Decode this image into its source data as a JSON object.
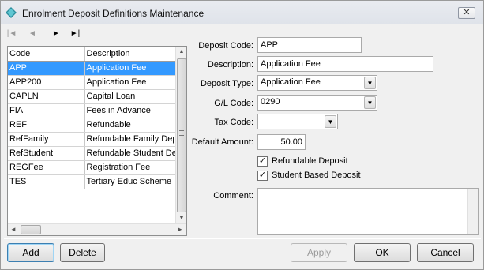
{
  "window": {
    "title": "Enrolment Deposit Definitions Maintenance"
  },
  "toolbar": {
    "buttons": [
      {
        "name": "first-record-icon",
        "glyph": "|◄"
      },
      {
        "name": "previous-record-icon",
        "glyph": "◄"
      },
      {
        "name": "next-record-icon",
        "glyph": "►"
      },
      {
        "name": "last-record-icon",
        "glyph": "►|"
      }
    ]
  },
  "list": {
    "columns": [
      "Code",
      "Description"
    ],
    "rows": [
      {
        "code": "APP",
        "description": "Application Fee"
      },
      {
        "code": "APP200",
        "description": "Application Fee"
      },
      {
        "code": "CAPLN",
        "description": "Capital Loan"
      },
      {
        "code": "FIA",
        "description": "Fees in Advance"
      },
      {
        "code": "REF",
        "description": "Refundable"
      },
      {
        "code": "RefFamily",
        "description": "Refundable Family Depo"
      },
      {
        "code": "RefStudent",
        "description": "Refundable Student De"
      },
      {
        "code": "REGFee",
        "description": "Registration Fee"
      },
      {
        "code": "TES",
        "description": "Tertiary Educ Scheme"
      }
    ],
    "selected_index": 0
  },
  "form": {
    "deposit_code_label": "Deposit Code:",
    "deposit_code": "APP",
    "description_label": "Description:",
    "description": "Application Fee",
    "deposit_type_label": "Deposit Type:",
    "deposit_type": "Application Fee",
    "gl_code_label": "G/L Code:",
    "gl_code": "0290",
    "tax_code_label": "Tax Code:",
    "tax_code": "",
    "default_amount_label": "Default Amount:",
    "default_amount": "50.00",
    "refundable_label": "Refundable Deposit",
    "refundable_checked": true,
    "student_based_label": "Student Based Deposit",
    "student_based_checked": true,
    "comment_label": "Comment:",
    "comment": ""
  },
  "buttons": {
    "add": "Add",
    "delete": "Delete",
    "apply": "Apply",
    "ok": "OK",
    "cancel": "Cancel"
  }
}
